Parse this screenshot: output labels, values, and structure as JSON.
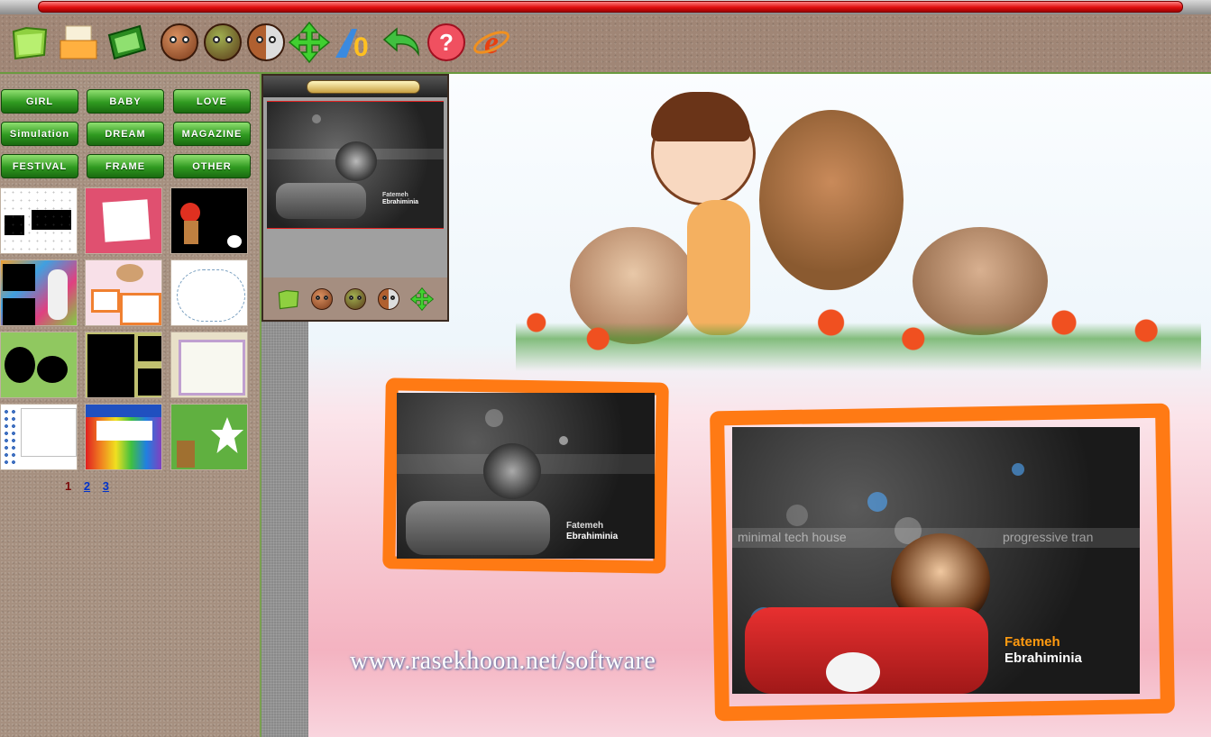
{
  "toolbar": {
    "icons": [
      "open-folder-icon",
      "print-icon",
      "open-image-icon",
      "face-zoom-icon",
      "face-edit-icon",
      "face-half-icon",
      "move-arrows-icon",
      "text-tool-icon",
      "undo-arrow-icon",
      "help-icon",
      "internet-explorer-icon"
    ]
  },
  "sidebar": {
    "categories": [
      "GIRL",
      "BABY",
      "LOVE",
      "Simulation",
      "DREAM",
      "MAGAZINE",
      "FESTIVAL",
      "FRAME",
      "OTHER"
    ],
    "pages": [
      "1",
      "2",
      "3"
    ],
    "current_page": "1"
  },
  "preview": {
    "caption_line1": "Fatemeh",
    "caption_line2": "Ebrahiminia"
  },
  "canvas": {
    "small_photo": {
      "caption_line1": "Fatemeh",
      "caption_line2": "Ebrahiminia"
    },
    "large_photo": {
      "caption_line1": "Fatemeh",
      "caption_line2": "Ebrahiminia",
      "banner_text": "minimal tech house",
      "banner_text2": "progressive tran"
    },
    "watermark": "www.rasekhoon.net/software"
  },
  "colors": {
    "frame_orange": "#ff7a14",
    "caption_orange": "#ff9a10",
    "button_green": "#2f9a20"
  }
}
